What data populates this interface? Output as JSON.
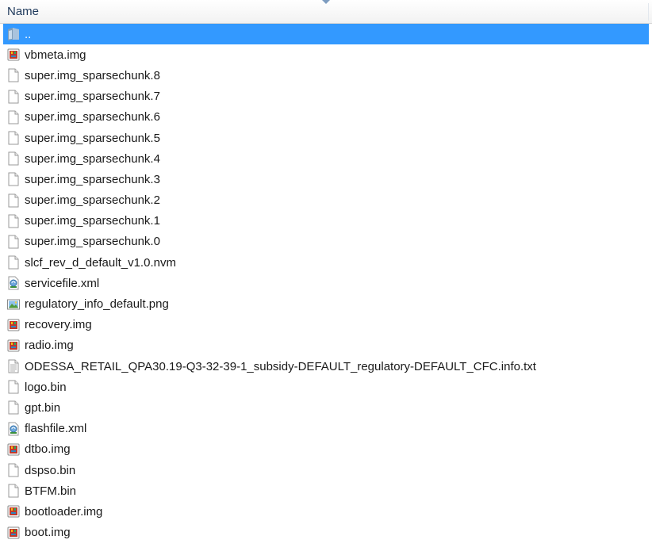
{
  "header": {
    "name_label": "Name"
  },
  "files": [
    {
      "name": "..",
      "icon": "folder-up-icon",
      "selected": true
    },
    {
      "name": "vbmeta.img",
      "icon": "img-file-icon"
    },
    {
      "name": "super.img_sparsechunk.8",
      "icon": "blank-file-icon"
    },
    {
      "name": "super.img_sparsechunk.7",
      "icon": "blank-file-icon"
    },
    {
      "name": "super.img_sparsechunk.6",
      "icon": "blank-file-icon"
    },
    {
      "name": "super.img_sparsechunk.5",
      "icon": "blank-file-icon"
    },
    {
      "name": "super.img_sparsechunk.4",
      "icon": "blank-file-icon"
    },
    {
      "name": "super.img_sparsechunk.3",
      "icon": "blank-file-icon"
    },
    {
      "name": "super.img_sparsechunk.2",
      "icon": "blank-file-icon"
    },
    {
      "name": "super.img_sparsechunk.1",
      "icon": "blank-file-icon"
    },
    {
      "name": "super.img_sparsechunk.0",
      "icon": "blank-file-icon"
    },
    {
      "name": "slcf_rev_d_default_v1.0.nvm",
      "icon": "blank-file-icon"
    },
    {
      "name": "servicefile.xml",
      "icon": "xml-file-icon"
    },
    {
      "name": "regulatory_info_default.png",
      "icon": "png-file-icon"
    },
    {
      "name": "recovery.img",
      "icon": "img-file-icon"
    },
    {
      "name": "radio.img",
      "icon": "img-file-icon"
    },
    {
      "name": "ODESSA_RETAIL_QPA30.19-Q3-32-39-1_subsidy-DEFAULT_regulatory-DEFAULT_CFC.info.txt",
      "icon": "text-file-icon"
    },
    {
      "name": "logo.bin",
      "icon": "blank-file-icon"
    },
    {
      "name": "gpt.bin",
      "icon": "blank-file-icon"
    },
    {
      "name": "flashfile.xml",
      "icon": "xml-file-icon"
    },
    {
      "name": "dtbo.img",
      "icon": "img-file-icon"
    },
    {
      "name": "dspso.bin",
      "icon": "blank-file-icon"
    },
    {
      "name": "BTFM.bin",
      "icon": "blank-file-icon"
    },
    {
      "name": "bootloader.img",
      "icon": "img-file-icon"
    },
    {
      "name": "boot.img",
      "icon": "img-file-icon"
    }
  ]
}
